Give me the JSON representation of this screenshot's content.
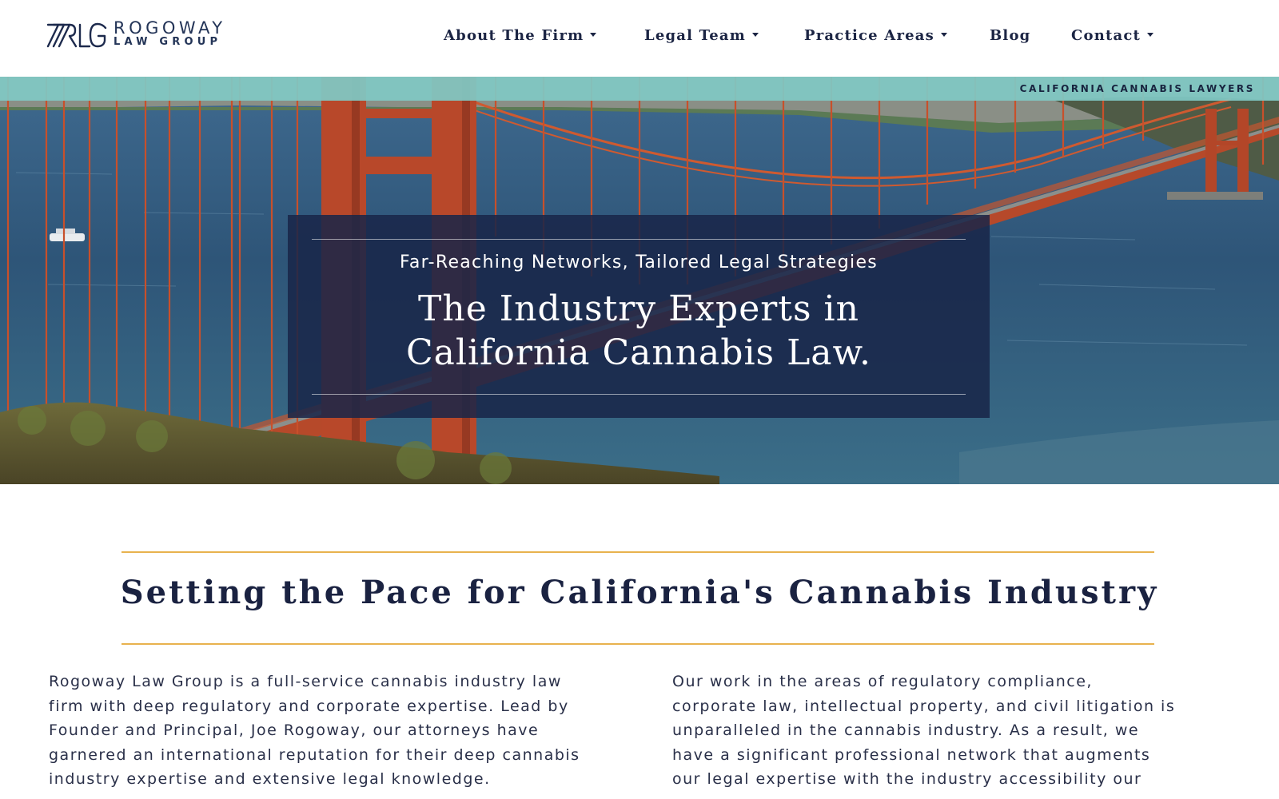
{
  "logo": {
    "monogram": "RLG",
    "name": "ROGOWAY",
    "subtitle": "LAW GROUP"
  },
  "nav": {
    "items": [
      {
        "label": "About The Firm",
        "has_dropdown": true
      },
      {
        "label": "Legal Team",
        "has_dropdown": true
      },
      {
        "label": "Practice Areas",
        "has_dropdown": true
      },
      {
        "label": "Blog",
        "has_dropdown": false
      },
      {
        "label": "Contact",
        "has_dropdown": true
      }
    ]
  },
  "hero": {
    "strip_label": "CALIFORNIA CANNABIS LAWYERS",
    "tagline": "Far-Reaching Networks, Tailored Legal Strategies",
    "headline_line1": "The Industry Experts in",
    "headline_line2": "California Cannabis Law."
  },
  "intro": {
    "title": "Setting the Pace for California's Cannabis Industry",
    "left_lines": [
      "Rogoway Law Group is a full-service cannabis industry law",
      "firm with deep regulatory and corporate expertise. Lead by",
      "Founder and Principal, Joe Rogoway, our attorneys have",
      "garnered an international reputation for their deep cannabis",
      "industry expertise and extensive legal knowledge."
    ],
    "right_lines": [
      "Our work in the areas of regulatory compliance,",
      "corporate law, intellectual property, and civil litigation is",
      "unparalleled in the cannabis industry. As a result, we",
      "have a significant professional network that augments",
      "our legal expertise with the industry accessibility our"
    ]
  },
  "colors": {
    "navy": "#1b2340",
    "teal": "#80c8c4",
    "gold": "#e8b24e",
    "bridge": "#c2502e"
  },
  "icons": [
    "caret-down-icon",
    "rlg-monogram-logo"
  ]
}
